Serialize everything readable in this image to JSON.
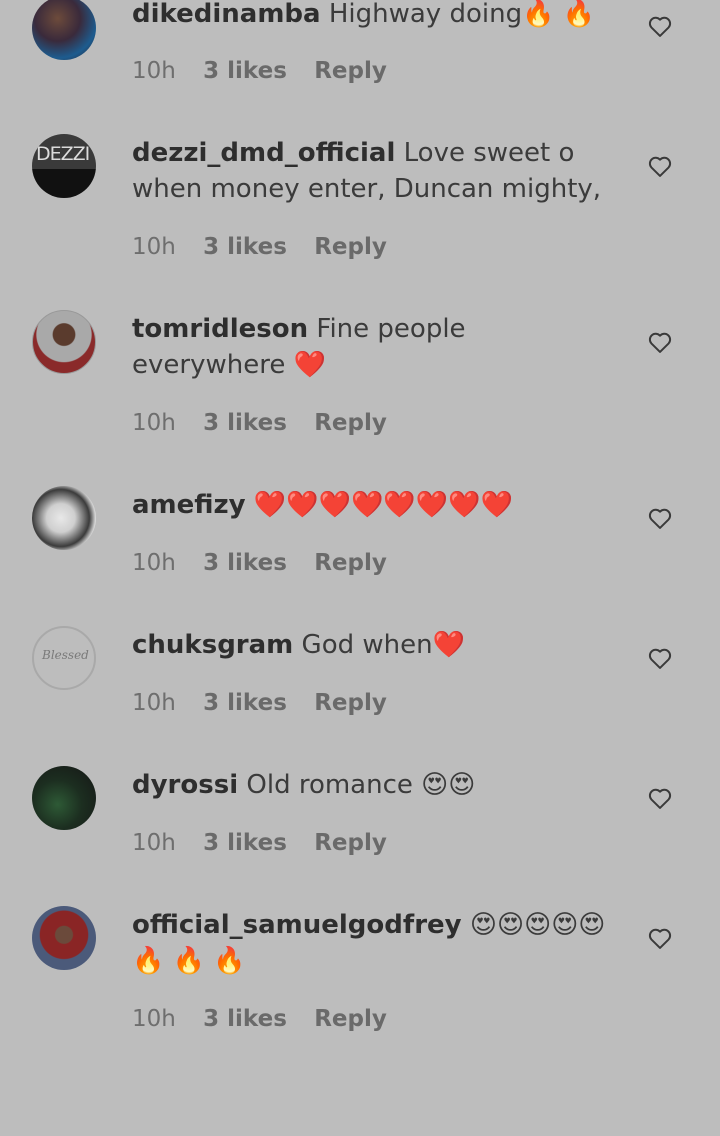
{
  "comments": [
    {
      "username": "dikedinamba",
      "text": "Highway doing🔥 🔥",
      "time": "10h",
      "likes": "3 likes",
      "reply": "Reply"
    },
    {
      "username": "dezzi_dmd_official",
      "text": "Love sweet o when money enter, Duncan mighty,",
      "time": "10h",
      "likes": "3 likes",
      "reply": "Reply",
      "avatar_text": "DEZZI"
    },
    {
      "username": "tomridleson",
      "text": "Fine people everywhere ❤️",
      "time": "10h",
      "likes": "3 likes",
      "reply": "Reply"
    },
    {
      "username": "amefizy",
      "text": "❤️❤️❤️❤️❤️❤️❤️❤️",
      "time": "10h",
      "likes": "3 likes",
      "reply": "Reply"
    },
    {
      "username": "chuksgram",
      "text": "God when❤️",
      "time": "10h",
      "likes": "3 likes",
      "reply": "Reply",
      "avatar_text": "Blessed"
    },
    {
      "username": "dyrossi",
      "text": "Old romance 😍😍",
      "time": "10h",
      "likes": "3 likes",
      "reply": "Reply"
    },
    {
      "username": "official_samuelgodfrey",
      "text": "😍😍😍😍😍 🔥 🔥 🔥",
      "time": "10h",
      "likes": "3 likes",
      "reply": "Reply"
    }
  ],
  "icons": {
    "like": "heart-outline-icon"
  },
  "colors": {
    "background": "#bdbdbd",
    "text": "#3b3b3b",
    "meta": "#6e6e6e"
  }
}
